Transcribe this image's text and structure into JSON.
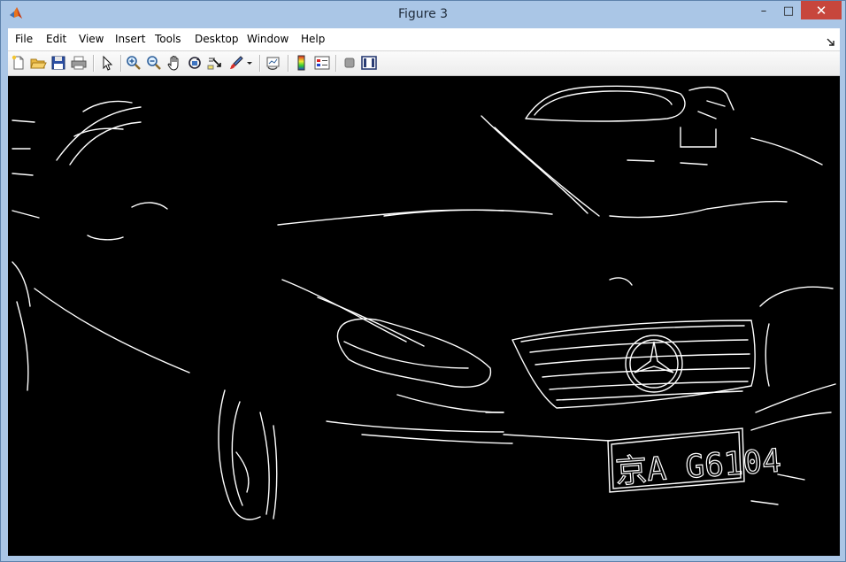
{
  "window": {
    "title": "Figure 3",
    "controls": {
      "minimize": "–",
      "maximize": "□",
      "close": "✕"
    }
  },
  "menu": {
    "items": [
      "File",
      "Edit",
      "View",
      "Insert",
      "Tools",
      "Desktop",
      "Window",
      "Help"
    ]
  },
  "toolbar": {
    "buttons": [
      "new-figure-icon",
      "open-file-icon",
      "save-icon",
      "print-icon",
      "edit-plot-arrow-icon",
      "zoom-in-icon",
      "zoom-out-icon",
      "pan-hand-icon",
      "rotate-3d-icon",
      "data-cursor-icon",
      "brush-icon",
      "brush-dropdown-icon",
      "link-plot-icon",
      "insert-colorbar-icon",
      "insert-legend-icon",
      "hide-plot-tools-icon",
      "show-plot-tools-icon"
    ]
  },
  "figure": {
    "description_free": true,
    "plate_text": "京A G6104",
    "colors": {
      "background": "#000000",
      "edges": "#ffffff"
    }
  }
}
